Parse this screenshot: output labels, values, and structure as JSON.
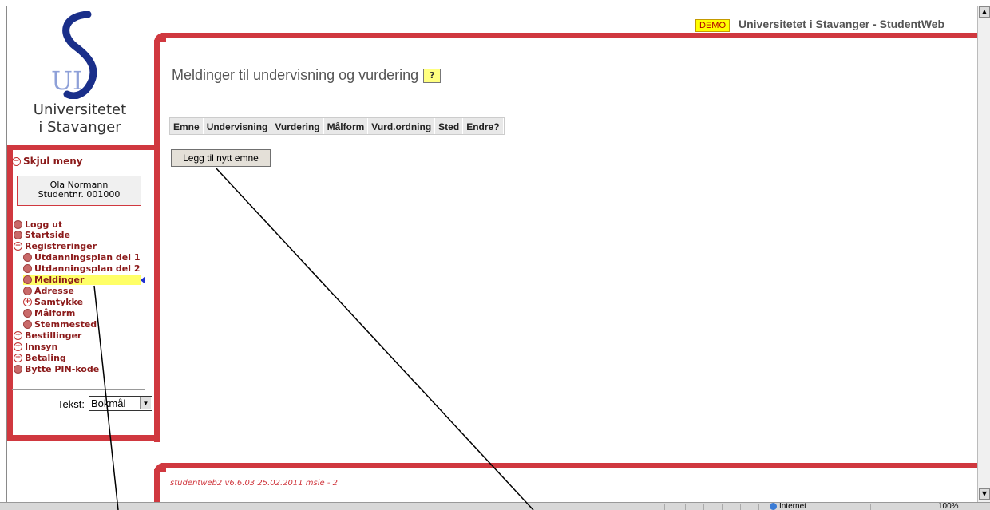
{
  "header": {
    "demo_badge": "DEMO",
    "title": "Universitetet i Stavanger - StudentWeb"
  },
  "logo": {
    "line1": "Universitetet",
    "line2": "i Stavanger",
    "monogram": "UI"
  },
  "menu": {
    "toggle_label": "Skjul meny",
    "user_name": "Ola Normann",
    "student_number": "Studentnr. 001000",
    "items": [
      {
        "label": "Logg ut",
        "icon": "dot"
      },
      {
        "label": "Startside",
        "icon": "dot"
      },
      {
        "label": "Registreringer",
        "icon": "minus"
      },
      {
        "label": "Utdanningsplan del 1",
        "icon": "dot"
      },
      {
        "label": "Utdanningsplan del 2",
        "icon": "dot"
      },
      {
        "label": "Meldinger",
        "icon": "dot",
        "active": true
      },
      {
        "label": "Adresse",
        "icon": "dot"
      },
      {
        "label": "Samtykke",
        "icon": "plus"
      },
      {
        "label": "Målform",
        "icon": "dot"
      },
      {
        "label": "Stemmested",
        "icon": "dot"
      },
      {
        "label": "Bestillinger",
        "icon": "plus"
      },
      {
        "label": "Innsyn",
        "icon": "plus"
      },
      {
        "label": "Betaling",
        "icon": "plus"
      },
      {
        "label": "Bytte PIN-kode",
        "icon": "dot"
      }
    ],
    "language_label": "Tekst:",
    "language_value": "Bokmål"
  },
  "main": {
    "title": "Meldinger til undervisning og vurdering",
    "help_icon": "?",
    "table_headers": [
      "Emne",
      "Undervisning",
      "Vurdering",
      "Målform",
      "Vurd.ordning",
      "Sted",
      "Endre?"
    ],
    "add_button": "Legg til nytt emne"
  },
  "footer": {
    "version": "studentweb2 v6.6.03 25.02.2011 msie - 2"
  },
  "statusbar": {
    "zone": "Internet",
    "zoom": "100%"
  },
  "colors": {
    "accent_red": "#d0383f",
    "menu_text": "#8b1a1a",
    "active_highlight": "#ffff66",
    "demo_badge_bg": "#ffff00"
  }
}
